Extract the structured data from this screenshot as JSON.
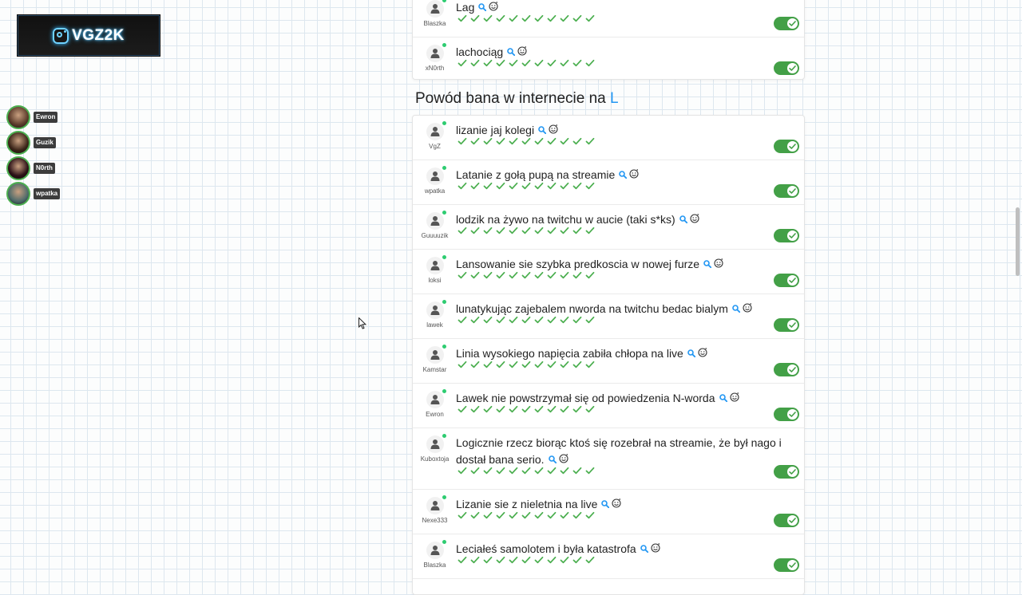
{
  "brand": {
    "logo_text": "VGZ2K",
    "logo_icon": "instagram-icon"
  },
  "viewers": [
    {
      "name": "Ewron",
      "color": "#5a3a2a"
    },
    {
      "name": "Guzik",
      "color": "#3a2418"
    },
    {
      "name": "N0rth",
      "color": "#2a0f16"
    },
    {
      "name": "wpatka",
      "color": "#4d6a6a"
    }
  ],
  "top_list": [
    {
      "user": "Blaszka",
      "text": "Lag"
    },
    {
      "user": "xN0rth",
      "text": "lachociąg"
    }
  ],
  "section": {
    "title": "Powód bana w internecie na",
    "letter": "L"
  },
  "entries": [
    {
      "user": "VgZ",
      "text": "lizanie jaj kolegi"
    },
    {
      "user": "wpatka",
      "text": "Latanie z gołą pupą na streamie"
    },
    {
      "user": "Guuuuzik",
      "text": "lodzik na żywo na twitchu w aucie (taki s*ks)"
    },
    {
      "user": "loksi",
      "text": "Lansowanie sie szybka predkoscia w nowej furze"
    },
    {
      "user": "lawek",
      "text": "lunatykując zajebalem nworda na twitchu bedac bialym"
    },
    {
      "user": "Kamstar",
      "text": "Linia wysokiego napięcia zabiła chłopa na live"
    },
    {
      "user": "Ewron",
      "text": "Lawek nie powstrzymał się od powiedzenia N-worda"
    },
    {
      "user": "Kuboxtoja",
      "text": "Logicznie rzecz biorąc ktoś się rozebrał na streamie, że był nago i dostał bana serio."
    },
    {
      "user": "Nexe333",
      "text": "Lizanie sie z nieletnia na live"
    },
    {
      "user": "Blaszka",
      "text": "Leciałeś samolotem i była katastrofa"
    }
  ],
  "colors": {
    "accent": "#2196f3",
    "check": "#4caf50",
    "toggle": "#43a047",
    "online": "#2ecc71"
  },
  "icons": {
    "search": "search-icon",
    "emoji": "emoji-icon",
    "user": "user-icon",
    "check": "check-icon"
  }
}
